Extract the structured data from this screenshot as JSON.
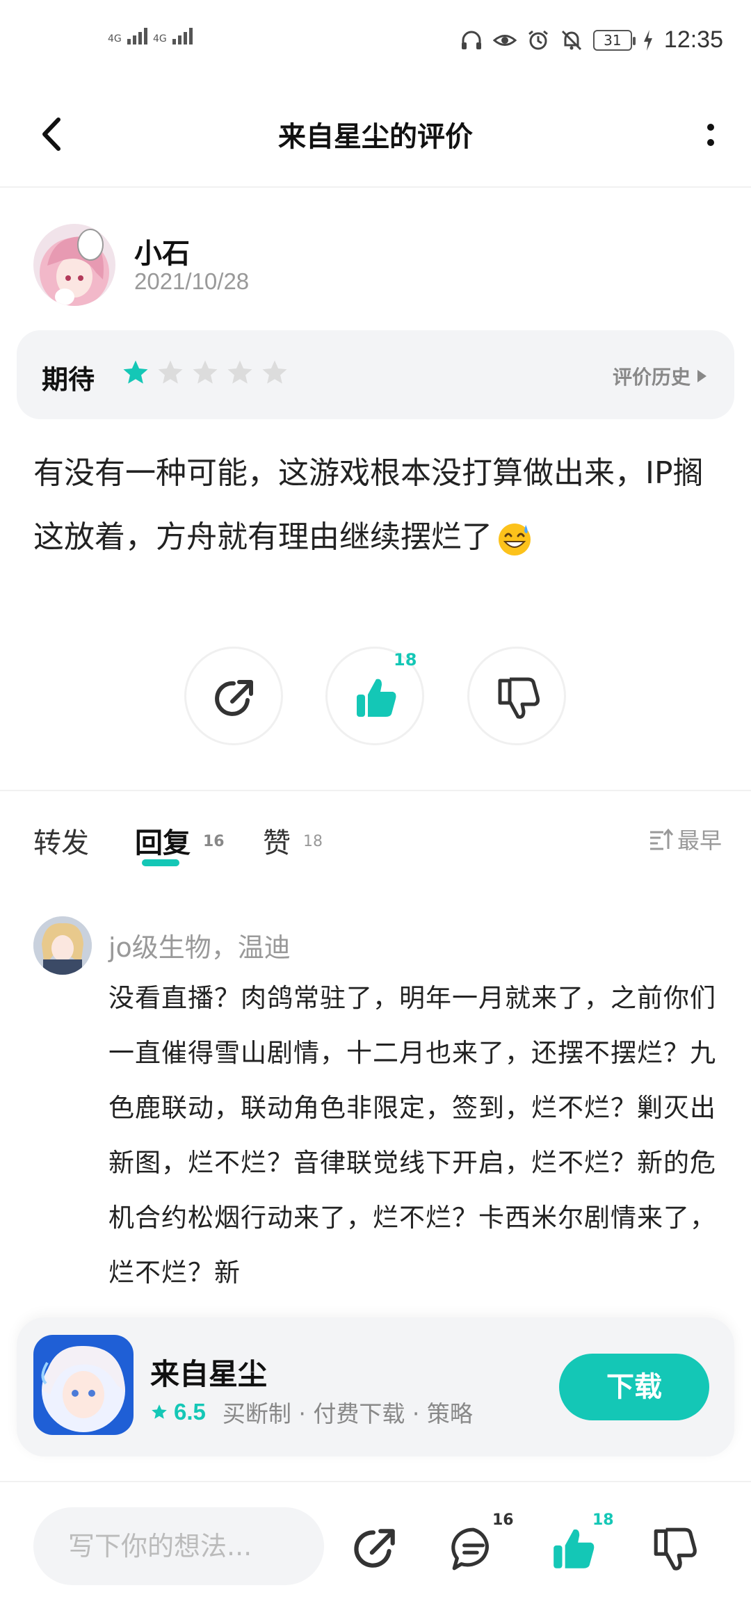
{
  "status_bar": {
    "sim1": "4G",
    "sim2": "4G",
    "battery": "31",
    "time": "12:35",
    "icons": [
      "headphones-icon",
      "eye-icon",
      "alarm-icon",
      "mute-bell-icon",
      "charging-icon"
    ]
  },
  "header": {
    "title": "来自星尘的评价",
    "back_icon": "chevron-left-icon",
    "more_icon": "more-vertical-icon"
  },
  "review": {
    "author": "小石",
    "date": "2021/10/28",
    "rating_label": "期待",
    "stars_filled": 1,
    "stars_total": 5,
    "history_label": "评价历史",
    "text": "有没有一种可能，这游戏根本没打算做出来，IP搁这放着，方舟就有理由继续摆烂了",
    "like_count": "18"
  },
  "tabs": {
    "forward": "转发",
    "reply": "回复",
    "reply_count": "16",
    "like": "赞",
    "like_count": "18",
    "sort": "最早"
  },
  "comment": {
    "author": "jo级生物，温迪",
    "text": "没看直播？肉鸽常驻了，明年一月就来了，之前你们一直催得雪山剧情，十二月也来了，还摆不摆烂？九色鹿联动，联动角色非限定，签到，烂不烂？剿灭出新图，烂不烂？音律联觉线下开启，烂不烂？新的危机合约松烟行动来了，烂不烂？卡西米尔剧情来了，烂不烂？新"
  },
  "app_card": {
    "name": "来自星尘",
    "score": "6.5",
    "tags": "买断制 · 付费下载 · 策略",
    "download_label": "下载"
  },
  "bottom_bar": {
    "input_placeholder": "写下你的想法...",
    "reply_count": "16",
    "like_count": "18"
  },
  "colors": {
    "accent": "#14c7b6",
    "muted": "#999999",
    "card_bg": "#f3f4f6"
  }
}
